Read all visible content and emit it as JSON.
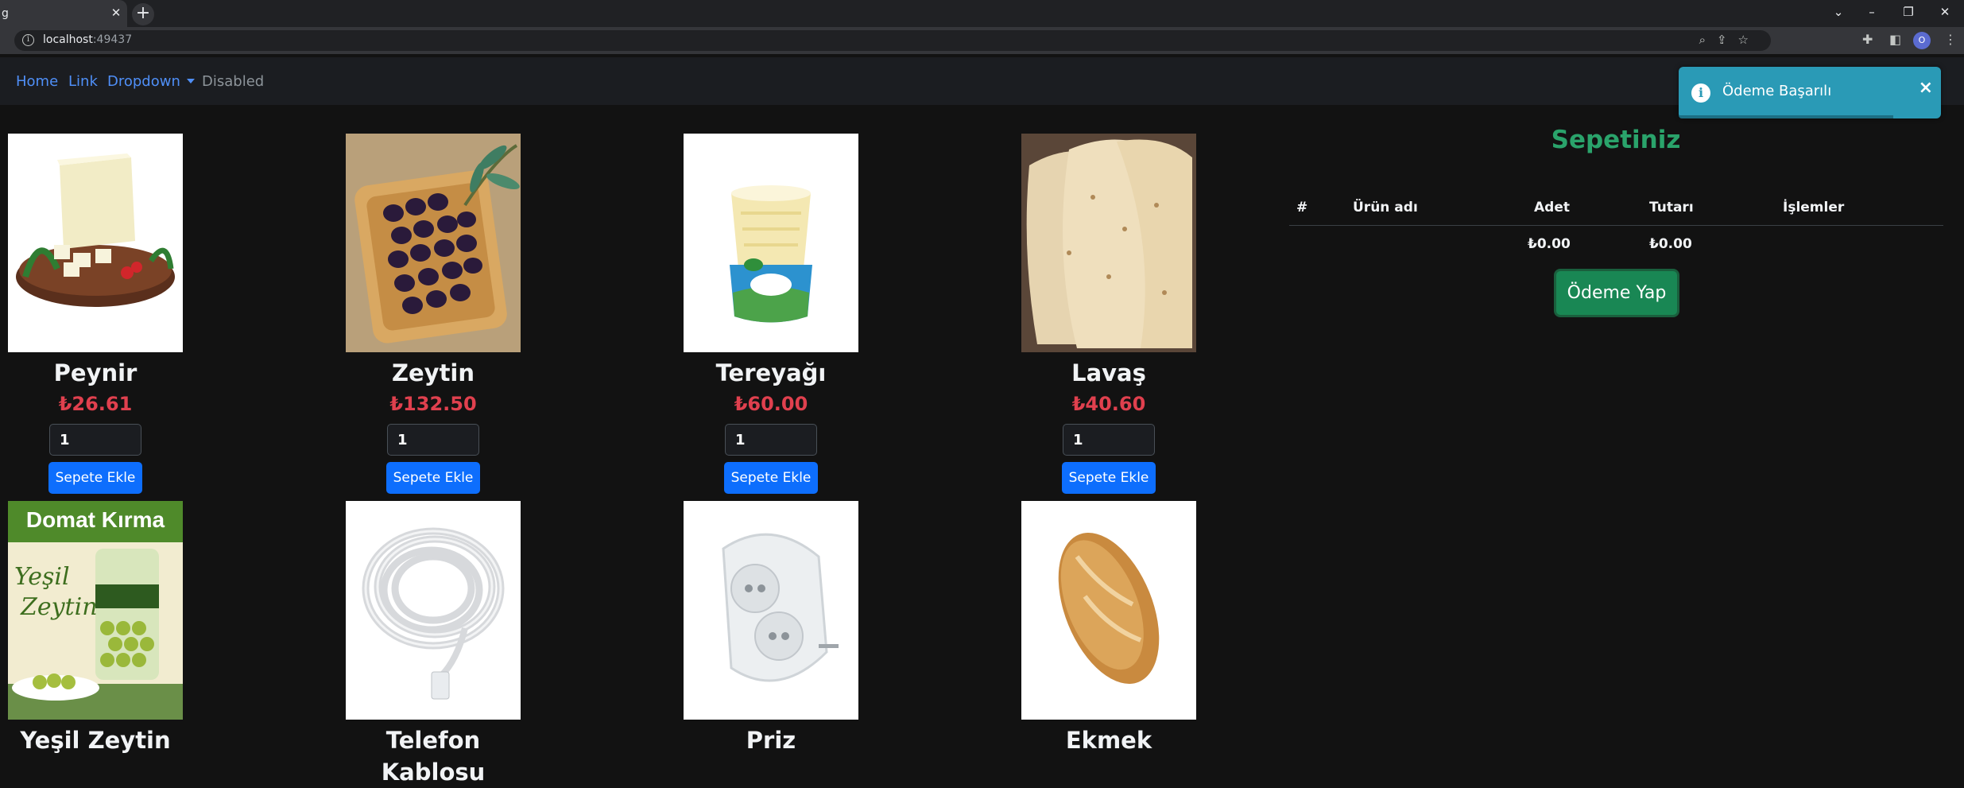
{
  "browser": {
    "tab_title": "g",
    "tab_close": "✕",
    "new_tab": "+",
    "url_host": "localhost",
    "url_port": ":49437",
    "avatar_initial": "O"
  },
  "nav": {
    "home": "Home",
    "link": "Link",
    "dropdown": "Dropdown",
    "disabled": "Disabled"
  },
  "products": [
    {
      "name": "Peynir",
      "price": "₺26.61",
      "qty": "1",
      "button": "Sepete Ekle",
      "image": "cheese"
    },
    {
      "name": "Zeytin",
      "price": "₺132.50",
      "qty": "1",
      "button": "Sepete Ekle",
      "image": "olives"
    },
    {
      "name": "Tereyağı",
      "price": "₺60.00",
      "qty": "1",
      "button": "Sepete Ekle",
      "image": "butter"
    },
    {
      "name": "Lavaş",
      "price": "₺40.60",
      "qty": "1",
      "button": "Sepete Ekle",
      "image": "lavash"
    },
    {
      "name": "Yeşil Zeytin",
      "image": "green-olives",
      "image_text": [
        "Domat Kırma",
        "Yeşil",
        "Zeytin"
      ]
    },
    {
      "name": "Telefon Kablosu",
      "image": "phone-cable"
    },
    {
      "name": "Priz",
      "image": "socket"
    },
    {
      "name": "Ekmek",
      "image": "bread"
    }
  ],
  "cart": {
    "title": "Sepetiniz",
    "headers": {
      "num": "#",
      "name": "Ürün adı",
      "qty": "Adet",
      "total": "Tutarı",
      "actions": "İşlemler"
    },
    "totals": {
      "qty_total": "₺0.00",
      "amount_total": "₺0.00"
    },
    "pay_button": "Ödeme Yap"
  },
  "toast": {
    "message": "Ödeme Başarılı",
    "icon": "i",
    "close": "×",
    "color": "#2a9ab6"
  }
}
